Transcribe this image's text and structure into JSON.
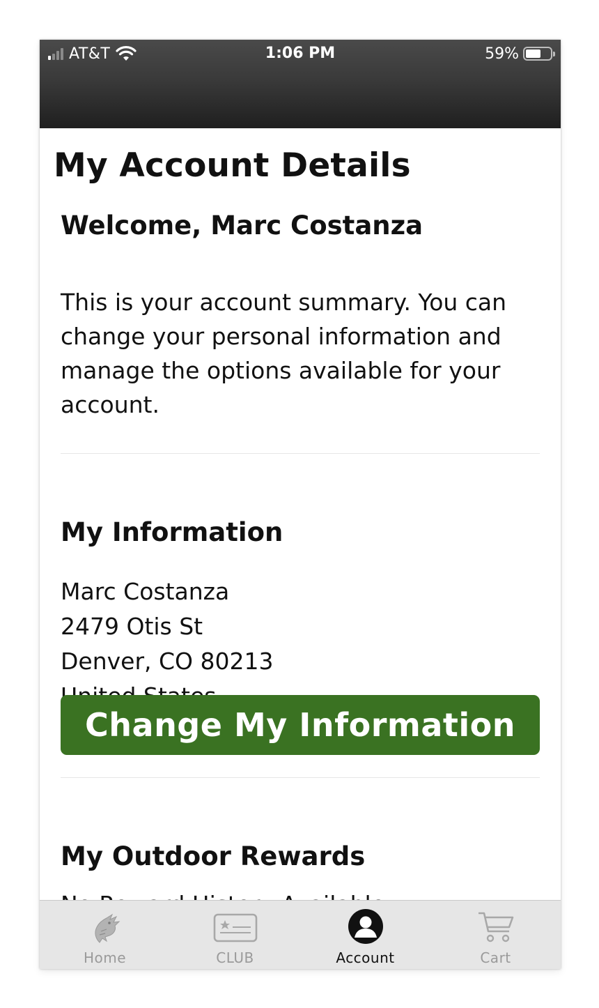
{
  "status_bar": {
    "carrier": "AT&T",
    "time": "1:06 PM",
    "battery": "59%"
  },
  "page": {
    "title": "My Account Details",
    "welcome": "Welcome, Marc Costanza",
    "summary": "This is your account summary. You can change your personal information and manage the options available for your account."
  },
  "my_information": {
    "heading": "My Information",
    "address_lines": [
      "Marc Costanza",
      "2479 Otis St",
      "Denver, CO 80213",
      "United States"
    ],
    "button_label": "Change My Information",
    "button_color": "#3a7222"
  },
  "rewards": {
    "heading": "My Outdoor Rewards",
    "empty_text": "No Reward History Available"
  },
  "tab_bar": {
    "tabs": [
      {
        "label": "Home",
        "icon": "fish-icon",
        "active": false
      },
      {
        "label": "CLUB",
        "icon": "club-card-icon",
        "active": false
      },
      {
        "label": "Account",
        "icon": "account-icon",
        "active": true
      },
      {
        "label": "Cart",
        "icon": "cart-icon",
        "active": false
      }
    ]
  }
}
